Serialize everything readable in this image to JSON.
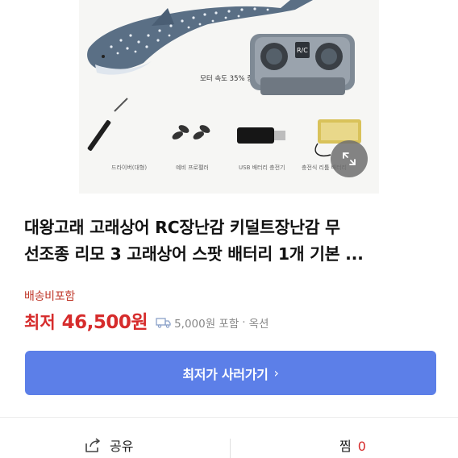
{
  "product_image": {
    "captions": {
      "speed": "모터 속도 35% 증가",
      "screwdriver": "드라이버(대형)",
      "propeller": "예비 프로펠러",
      "usb": "USB 배터리 충전기",
      "battery": "충전식 리튬 배터리"
    },
    "remote_text": "R/C"
  },
  "title_lines": [
    "대왕고래 고래상어 RC장난감 키덜트장난감 무",
    "선조종 리모 3 고래상어 스팟 배터리 1개 기본 ..."
  ],
  "shipping_label": "배송비포함",
  "price": {
    "prefix": "최저",
    "value": "46,500원"
  },
  "shipping_info": {
    "icon": "truck-icon",
    "text": "5,000원 포함",
    "separator": "·",
    "seller": "옥션"
  },
  "cta": {
    "label": "최저가 사러가기",
    "chevron": "›"
  },
  "bottom_bar": {
    "share_label": "공유",
    "like_label": "찜",
    "like_count": "0"
  },
  "colors": {
    "accent_red": "#d62c2c",
    "button_blue": "#5c7fe8",
    "muted_gray": "#888888"
  }
}
